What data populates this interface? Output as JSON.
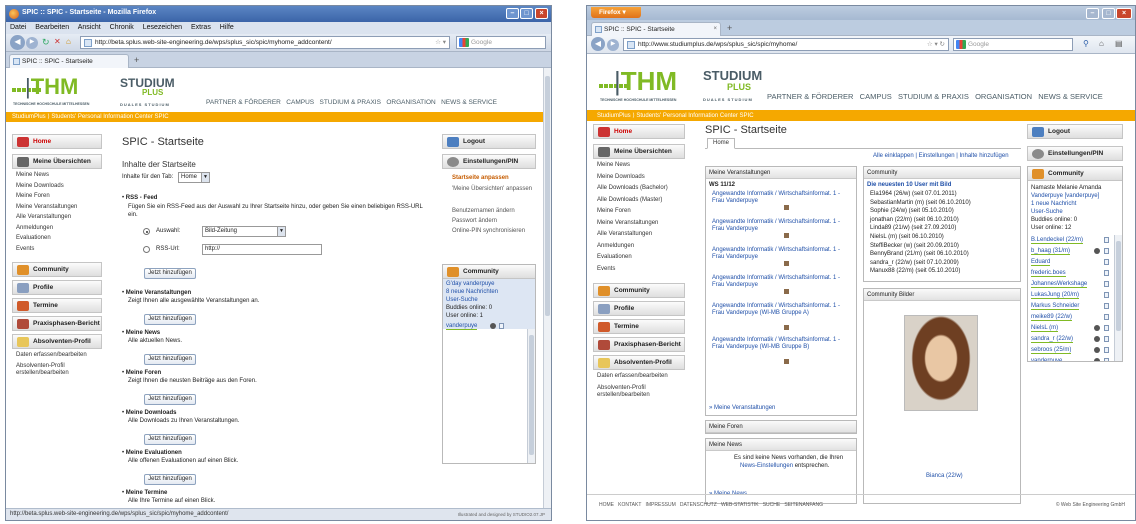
{
  "w1": {
    "title": "SPIC :: SPIC - Startseite - Mozilla Firefox",
    "menu": [
      "Datei",
      "Bearbeiten",
      "Ansicht",
      "Chronik",
      "Lesezeichen",
      "Extras",
      "Hilfe"
    ],
    "url": "http://beta.splus.web-site-engineering.de/wps/splus_sic/spic/myhome_addcontent/",
    "search": "Google",
    "tab": "SPIC :: SPIC - Startseite",
    "breadcrumb": "StudiumPlus ⟩ Students' Personal Information Center SPIC",
    "left": [
      {
        "label": "Home",
        "kind": "head"
      },
      {
        "label": "Meine Übersichten",
        "kind": "head"
      },
      {
        "label": "Meine News"
      },
      {
        "label": "Meine Downloads"
      },
      {
        "label": "Meine Foren"
      },
      {
        "label": "Meine Veranstaltungen"
      },
      {
        "label": "Alle Veranstaltungen"
      },
      {
        "label": "Anmeldungen"
      },
      {
        "label": "Evaluationen"
      },
      {
        "label": "Events"
      },
      {
        "label": "Community",
        "kind": "head"
      },
      {
        "label": "Profile",
        "kind": "head"
      },
      {
        "label": "Termine",
        "kind": "head"
      },
      {
        "label": "Praxisphasen-Bericht",
        "kind": "head"
      },
      {
        "label": "Absolventen-Profil",
        "kind": "head"
      },
      {
        "label": "Daten erfassen/bearbeiten"
      },
      {
        "label": "Absolventen-Profil erstellen/bearbeiten"
      }
    ],
    "page_title": "SPIC - Startseite",
    "content_heading": "Inhalte der Startseite",
    "tab_label": "Inhalte für den Tab:",
    "tab_value": "Home",
    "rss": {
      "title": "RSS - Feed",
      "desc": "Fügen Sie ein RSS-Feed aus der Auswahl zu Ihrer Startseite hinzu, oder geben Sie einen beliebigen RSS-URL ein.",
      "opt1": "Auswahl:",
      "opt1_value": "Bild-Zeitung",
      "opt2": "RSS-Url:",
      "opt2_value": "http://"
    },
    "add_label": "Jetzt hinzufügen",
    "sections": [
      {
        "title": "Meine Veranstaltungen",
        "desc": "Zeigt Ihnen alle ausgewählte Veranstaltungen an."
      },
      {
        "title": "Meine News",
        "desc": "Alle aktuellen News."
      },
      {
        "title": "Meine Foren",
        "desc": "Zeigt Ihnen die neusten Beiträge aus den Foren."
      },
      {
        "title": "Meine Downloads",
        "desc": "Alle Downloads zu Ihren Veranstaltungen."
      },
      {
        "title": "Meine Evaluationen",
        "desc": "Alle offenen Evaluationen auf einen Blick."
      },
      {
        "title": "Meine Termine",
        "desc": "Alle Ihre Termine auf einen Blick."
      }
    ],
    "right": {
      "logout": "Logout",
      "settings": "Einstellungen/PIN",
      "links": [
        "Startseite anpassen",
        "'Meine Übersichten' anpassen",
        "Benutzernamen ändern",
        "Passwort ändern",
        "Online-PIN synchronisieren"
      ],
      "community": "Community",
      "greeting": "G'day vanderpuye",
      "news": "8 neue Nachrichten",
      "search": "User-Suche",
      "buddies": "Buddies online: 0",
      "online": "User online: 1",
      "user": "vanderpuye"
    },
    "status": "http://beta.splus.web-site-engineering.de/wps/splus_sic/spic/myhome_addcontent/",
    "credit": "Illustrated and designed by STUDIO2.07.JP"
  },
  "w2": {
    "firefox_btn": "Firefox",
    "tab": "SPIC :: SPIC - Startseite",
    "url": "http://www.studiumplus.de/wps/splus_sic/spic/myhome/",
    "search": "Google",
    "nav": "PARTNER & FÖRDERER   CAMPUS   STUDIUM & PRAXIS   ORGANISATION   NEWS & SERVICE",
    "breadcrumb": "StudiumPlus ⟩ Students' Personal Information Center SPIC",
    "left": [
      {
        "label": "Home",
        "kind": "head"
      },
      {
        "label": "Meine Übersichten",
        "kind": "head"
      },
      {
        "label": "Meine News"
      },
      {
        "label": "Meine Downloads"
      },
      {
        "label": "Alle Downloads (Bachelor)"
      },
      {
        "label": "Alle Downloads (Master)"
      },
      {
        "label": "Meine Foren"
      },
      {
        "label": "Meine Veranstaltungen"
      },
      {
        "label": "Alle Veranstaltungen"
      },
      {
        "label": "Anmeldungen"
      },
      {
        "label": "Evaluationen"
      },
      {
        "label": "Events"
      },
      {
        "label": "Community",
        "kind": "head"
      },
      {
        "label": "Profile",
        "kind": "head"
      },
      {
        "label": "Termine",
        "kind": "head"
      },
      {
        "label": "Praxisphasen-Bericht",
        "kind": "head"
      },
      {
        "label": "Absolventen-Profil",
        "kind": "head"
      },
      {
        "label": "Daten erfassen/bearbeiten"
      },
      {
        "label": "Absolventen-Profil erstellen/bearbeiten"
      }
    ],
    "page_title": "SPIC - Startseite",
    "home_tab": "Home",
    "toolbar_links": "Alle einklappen | Einstellungen | Inhalte hinzufügen",
    "veranst": {
      "title": "Meine Veranstaltungen",
      "ws": "WS 11/12",
      "items": [
        "Angewandte Informatik / Wirtschaftsinformat. 1 - Frau Vanderpuye",
        "Angewandte Informatik / Wirtschaftsinformat. 1 - Frau Vanderpuye",
        "Angewandte Informatik / Wirtschaftsinformat. 1 - Frau Vanderpuye",
        "Angewandte Informatik / Wirtschaftsinformat. 1 - Frau Vanderpuye",
        "Angewandte Informatik / Wirtschaftsinformat. 1 - Frau Vanderpuye (WI-MB Gruppe A)",
        "Angewandte Informatik / Wirtschaftsinformat. 1 - Frau Vanderpuye (WI-MB Gruppe B)"
      ],
      "more": "» Meine Veranstaltungen"
    },
    "foren": "Meine Foren",
    "news": {
      "title": "Meine News",
      "text": "Es sind keine News vorhanden, die Ihren",
      "link": "News-Einstellungen",
      "tail": "entsprechen.",
      "more": "» Meine News"
    },
    "community": {
      "title": "Community",
      "subtitle": "Die neuesten 10 User mit Bild",
      "users": [
        "Ela1964 (26/w) (seit 07.01.2011)",
        "SebastianMartin (m) (seit 06.10.2010)",
        "Sophie (24/w) (seit 05.10.2010)",
        "jonathan (22/m) (seit 06.10.2010)",
        "Linda89 (21/w) (seit 27.09.2010)",
        "NielsL (m) (seit 06.10.2010)",
        "SteffiBecker (w) (seit 20.09.2010)",
        "BennyBrand (21/m) (seit 06.10.2010)",
        "sandra_r (22/w) (seit 07.10.2009)",
        "Manux88 (22/m) (seit 05.10.2010)"
      ]
    },
    "bilder": {
      "title": "Community Bilder",
      "caption": "Bianca (22/w)"
    },
    "right": {
      "logout": "Logout",
      "settings": "Einstellungen/PIN",
      "community": "Community",
      "info": [
        "Namaste Melanie Amanda",
        "Vanderpuye [vanderpuye]",
        "1 neue Nachricht",
        "User-Suche",
        "Buddies online: 0",
        "User online: 12"
      ],
      "users": [
        "B.Lendeckel (22/m)",
        "b_haag (31/m)",
        "Eduard",
        "frederic.boes",
        "JohannesWerkshage",
        "LukasJung (20/m)",
        "Markus Schneider",
        "meike89 (22/w)",
        "NielsL (m)",
        "sandra_r (22/w)",
        "sebroos (25/m)",
        "vanderpuye"
      ]
    },
    "footer": "HOME   KONTAKT   IMPRESSUM   DATENSCHUTZ   WEB-STATISTIK   SUCHE   SEITENANFANG",
    "copyright": "© Web Site Engineering GmbH"
  },
  "brand": {
    "thm": "THM",
    "thm_sub": "TECHNISCHE HOCHSCHULE MITTELHESSEN",
    "studium": "STUDIUM",
    "plus": "PLUS",
    "duales": "DUALES STUDIUM",
    "nav1": "PARTNER & FÖRDERER   CAMPUS   STUDIUM & PRAXIS   ORGANISATION   NEWS & SERVICE"
  },
  "colors": {
    "orange": "#f5a800",
    "green": "#80ba24",
    "link": "#1f4fa8"
  }
}
